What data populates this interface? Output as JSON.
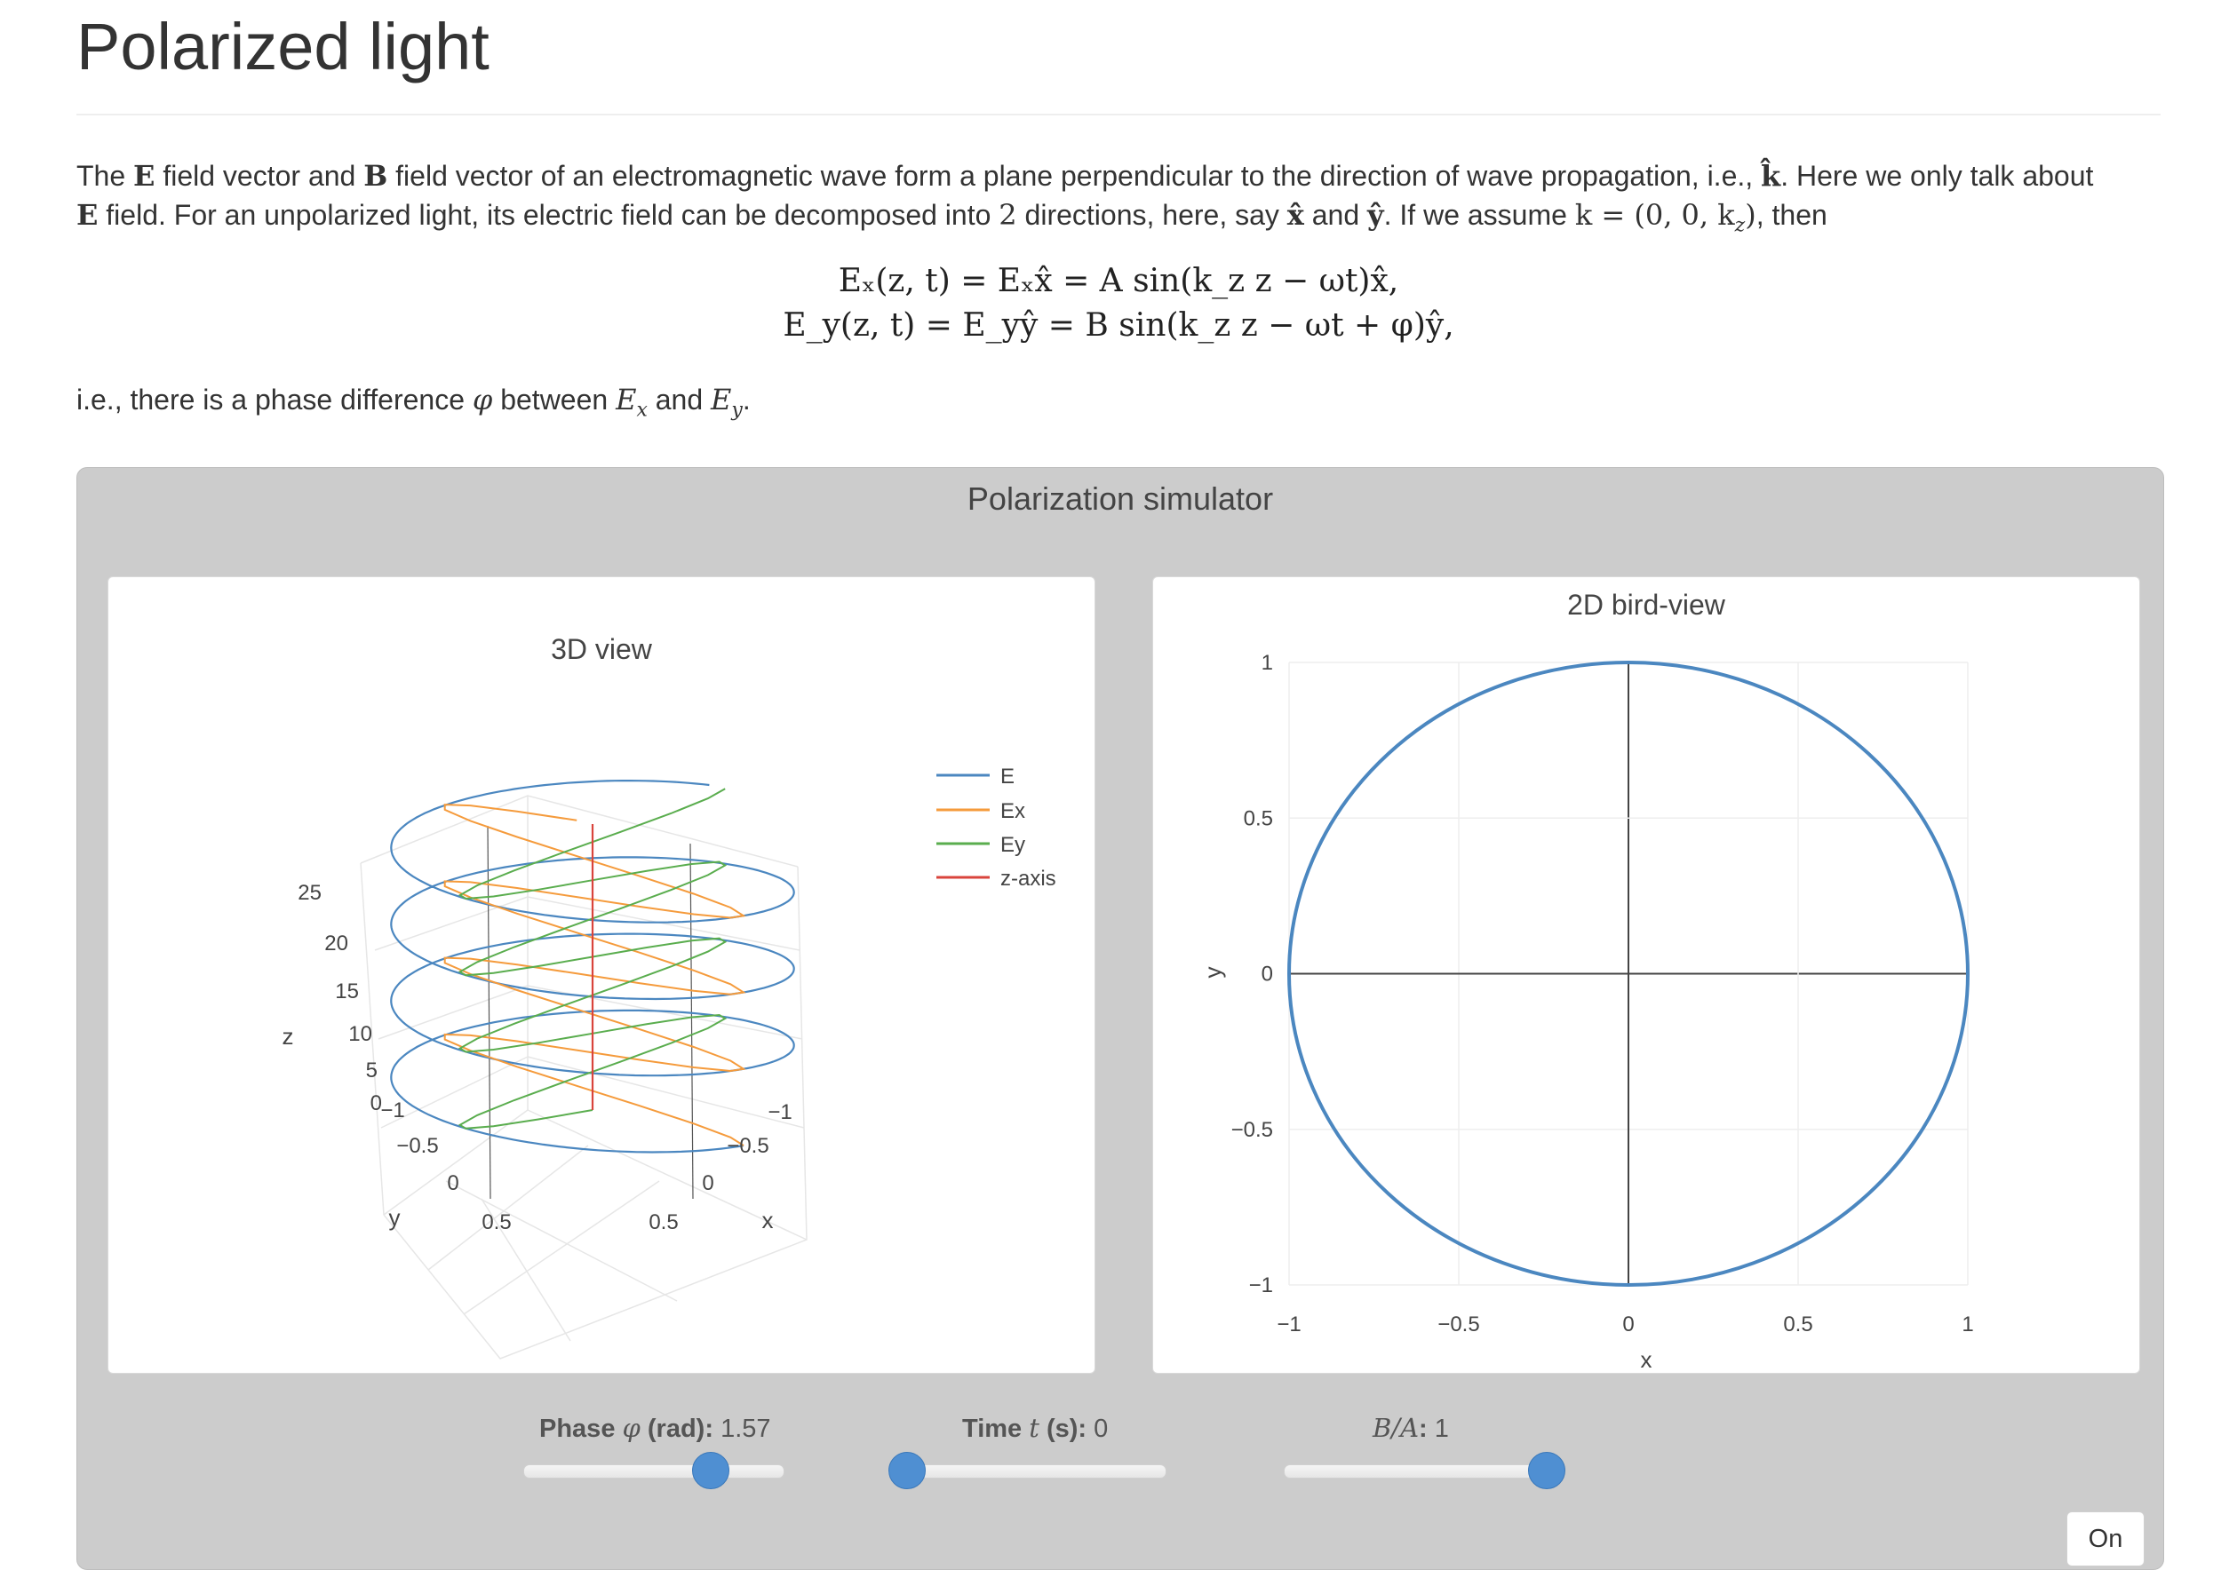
{
  "page": {
    "title": "Polarized light",
    "intro_1": "The",
    "intro_E": "E",
    "intro_2": "field vector and",
    "intro_B": "B",
    "intro_3": "field vector of an electromagnetic wave form a plane perpendicular to the direction of wave propagation, i.e.,",
    "intro_k": "k̂",
    "intro_4": ". Here we only talk about",
    "line2_E": "E",
    "line2_1": "field. For an unpolarized light, its electric field can be decomposed into",
    "line2_2": "2",
    "line2_3": "directions, here, say",
    "line2_x": "x̂",
    "line2_and": "and",
    "line2_y": "ŷ",
    "line2_4": ". If we assume",
    "line2_keq": "k = (0, 0, k",
    "line2_ksub": "z",
    "line2_kend": ")",
    "line2_5": ", then",
    "equation_1": "Eₓ(z, t) = Eₓx̂ = A sin(k_z z − ωt)x̂,",
    "equation_2": "E_y(z, t) = E_yŷ = B sin(k_z z − ωt + φ)ŷ,",
    "phase_1": "i.e., there is a phase difference",
    "phase_phi": "φ",
    "phase_2": "between",
    "phase_Ex": "E",
    "phase_Ex_sub": "x",
    "phase_and": "and",
    "phase_Ey": "E",
    "phase_Ey_sub": "y",
    "phase_end": "."
  },
  "simulator": {
    "title": "Polarization simulator",
    "on_button": "On",
    "controls": [
      {
        "label": "Phase",
        "symbol": "φ",
        "unit": "(rad):",
        "value": "1.57",
        "fraction": 0.75
      },
      {
        "label": "Time",
        "symbol": "t",
        "unit": "(s):",
        "value": "0",
        "fraction": 0.0
      },
      {
        "label": "",
        "symbol": "B/A",
        "unit": ":",
        "value": "1",
        "fraction": 1.0
      }
    ]
  },
  "view3d": {
    "title": "3D view",
    "legend": [
      "E",
      "Ex",
      "Ey",
      "z-axis"
    ],
    "colors": {
      "E": "#4b87c0",
      "Ex": "#f59b3c",
      "Ey": "#5aad4e",
      "z-axis": "#d9443c"
    },
    "z_axis_label": "z",
    "z_ticks": [
      "25",
      "20",
      "15",
      "10",
      "5",
      "0"
    ],
    "y_axis_label": "y",
    "y_ticks": [
      "−1",
      "−0.5",
      "0",
      "0.5"
    ],
    "x_axis_label": "x",
    "x_ticks": [
      "−1",
      "−0.5",
      "0",
      "0.5"
    ]
  },
  "chart_data": {
    "type": "line",
    "title": "2D bird-view",
    "xlabel": "x",
    "ylabel": "y",
    "xlim": [
      -1,
      1
    ],
    "ylim": [
      -1,
      1
    ],
    "x_ticks": [
      "−1",
      "−0.5",
      "0",
      "0.5",
      "1"
    ],
    "y_ticks": [
      "1",
      "0.5",
      "0",
      "−0.5",
      "−1"
    ],
    "grid": true,
    "series": [
      {
        "shape": "circle",
        "center": [
          0,
          0
        ],
        "radius": 1,
        "color": "#4b87c0"
      }
    ]
  }
}
